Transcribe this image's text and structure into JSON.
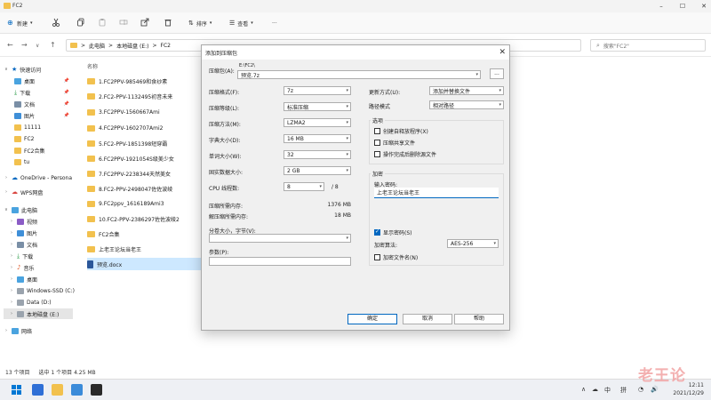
{
  "window": {
    "title": "FC2"
  },
  "ribbon": {
    "new_label": "新建",
    "sort_label": "排序",
    "view_label": "查看",
    "more_label": "···"
  },
  "address": {
    "path": [
      "此电脑",
      "本地磁盘 (E:)",
      "FC2"
    ],
    "separator": ">",
    "search_placeholder": "搜索\"FC2\""
  },
  "nav": {
    "quick_access": "快速访问",
    "items": [
      {
        "label": "桌面",
        "pinned": true
      },
      {
        "label": "下载",
        "pinned": true
      },
      {
        "label": "文档",
        "pinned": true
      },
      {
        "label": "图片",
        "pinned": true
      },
      {
        "label": "11111"
      },
      {
        "label": "FC2"
      },
      {
        "label": "FC2合集"
      },
      {
        "label": "tu"
      }
    ],
    "onedrive": "OneDrive - Persona",
    "wps": "WPS网盘",
    "this_pc": "此电脑",
    "pc_items": [
      "视频",
      "图片",
      "文档",
      "下载",
      "音乐",
      "桌面",
      "Windows-SSD (C:)",
      "Data (D:)",
      "本地磁盘 (E:)"
    ],
    "network": "网络"
  },
  "files": {
    "column_header": "名称",
    "items": [
      "1.FC2PPV-985469和食纱素",
      "2.FC2-PPV-1132495初音未来",
      "3.FC2PPV-1560667Ami",
      "4.FC2PPV-1602707Ami2",
      "5.FC2-PPV-1851398短穿霸",
      "6.FC2PPV-1921054S级美少女",
      "7.FC2PPV-2238344天然美女",
      "8.FC2-PPV-2498047佐佐波绫",
      "9.FC2ppv_1616189Ami3",
      "10.FC2-PPV-2386297佐佐波绫2",
      "FC2合集",
      "上老王论坛当老王",
      "预览.docx"
    ]
  },
  "status": {
    "count": "13 个项目",
    "selection": "选中 1 个项目 4.25 MB"
  },
  "dialog": {
    "title": "添加到压缩包",
    "archive_label": "压缩包(A):",
    "archive_dir": "E:\\FC2\\",
    "archive_name": "预览.7z",
    "browse": "...",
    "format_label": "压缩格式(F):",
    "format_value": "7z",
    "level_label": "压缩等级(L):",
    "level_value": "标准压缩",
    "method_label": "压缩方法(M):",
    "method_value": "LZMA2",
    "dict_label": "字典大小(D):",
    "dict_value": "16 MB",
    "word_label": "单词大小(W):",
    "word_value": "32",
    "solid_label": "固实数据大小:",
    "solid_value": "2 GB",
    "cpu_label": "CPU 线程数:",
    "cpu_value": "8",
    "cpu_total": "/ 8",
    "mem_comp_label": "压缩所需内存:",
    "mem_comp_value": "1376 MB",
    "mem_decomp_label": "解压缩所需内存:",
    "mem_decomp_value": "18 MB",
    "split_label": "分卷大小，字节(V):",
    "params_label": "参数(P):",
    "update_label": "更新方式(U):",
    "update_value": "添加并替换文件",
    "path_label": "路径模式",
    "path_value": "相对路径",
    "options_title": "选项",
    "opt_sfx": "创建自释放程序(X)",
    "opt_shared": "压缩共享文件",
    "opt_delete": "操作完成后删除源文件",
    "encryption_title": "加密",
    "password_label": "输入密码:",
    "password_value": "上老王论坛当老王",
    "show_password": "显示密码(S)",
    "enc_method_label": "加密算法:",
    "enc_method_value": "AES-256",
    "encrypt_names": "加密文件名(N)",
    "ok": "确定",
    "cancel": "取消",
    "help": "帮助"
  },
  "taskbar": {
    "ime": "中",
    "layout": "拼",
    "time": "12:11",
    "date": "2021/12/29"
  },
  "watermark": "老王论"
}
